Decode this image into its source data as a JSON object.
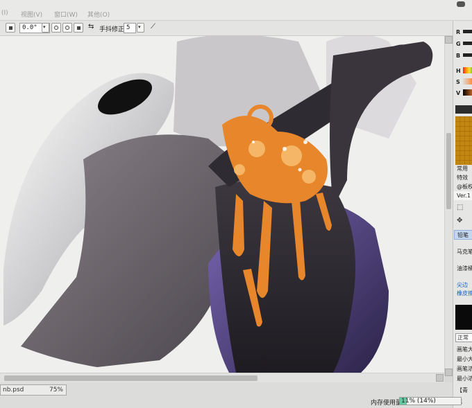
{
  "menu": {
    "items": [
      "视图(V)",
      "窗口(W)",
      "其他(O)"
    ],
    "partial_first": "(I)"
  },
  "toolbar": {
    "angle_value": "0.0°",
    "stabilizer_label": "手抖修正",
    "stabilizer_value": "5"
  },
  "right_panel": {
    "sliders": [
      "R",
      "G",
      "B",
      "H",
      "S",
      "V"
    ],
    "palette_tabs": [
      "常用",
      "特效",
      "@板权",
      "Ver.1"
    ],
    "tools": [
      "铅笔",
      "马克笔",
      "油漆桶",
      "尖边",
      "橡皮擦"
    ],
    "brush_labels": [
      "画笔大小",
      "最小大小",
      "画笔浓度",
      "最小浓度"
    ],
    "blend_mode": "正常",
    "bottom_label": "【青",
    "bottom_label_2": "磁",
    "colors": {
      "accent_selection": "#c5d7ef",
      "memory_fill": "#62c9a3"
    }
  },
  "document": {
    "filename": "nb.psd",
    "zoom": "75%"
  },
  "status": {
    "memory_label": "内存使用量",
    "memory_value": "11% (14%)",
    "memory_fraction": 0.11
  }
}
